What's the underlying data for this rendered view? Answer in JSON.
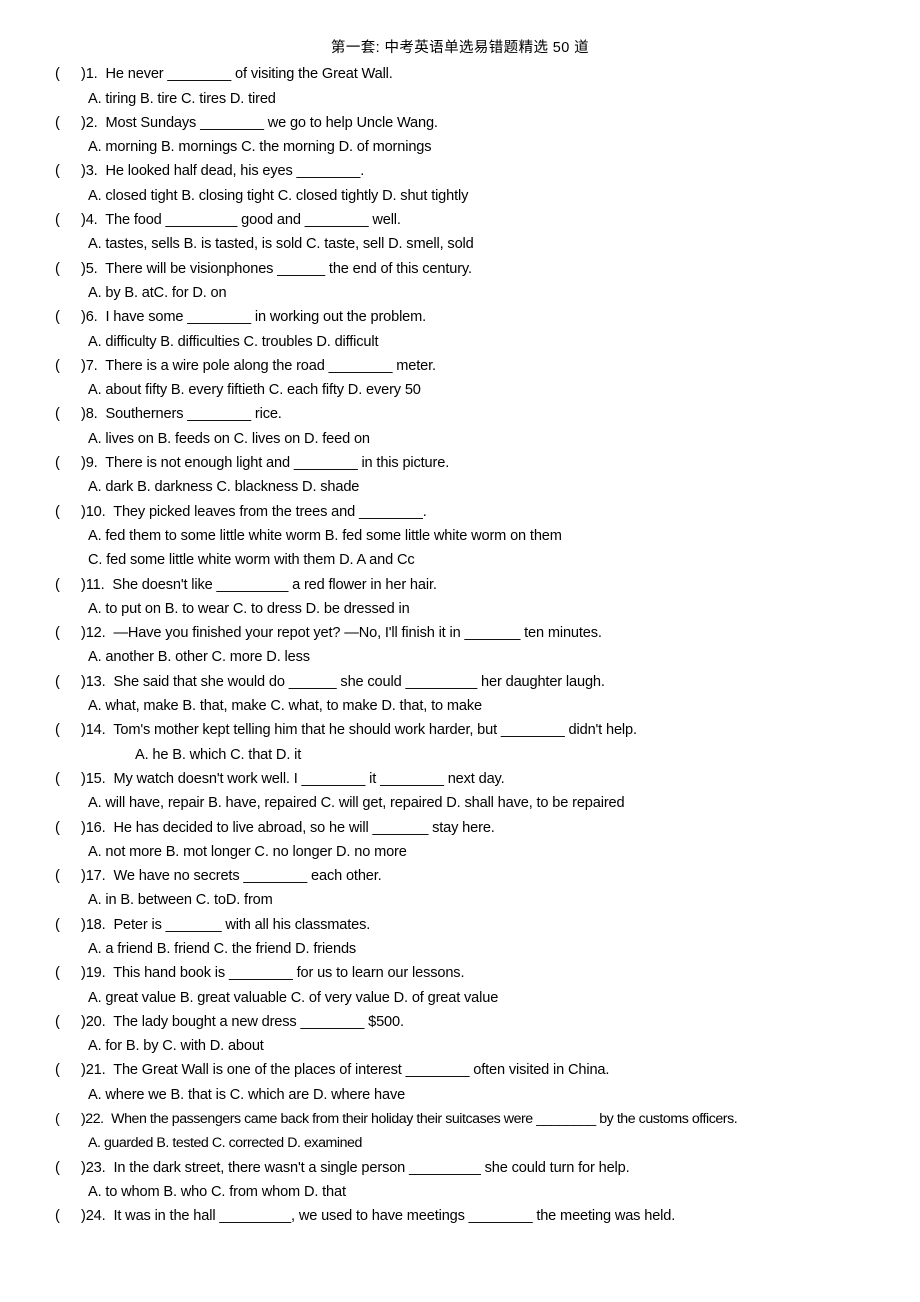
{
  "document": {
    "title": "第一套: 中考英语单选易错题精选 50 道",
    "bracket_open": "(",
    "bracket_close": ")"
  },
  "questions": [
    {
      "number": "1.",
      "stem": "He never ________ of visiting the Great Wall.",
      "option_lines": [
        "A. tiring  B. tire     C. tires    D. tired"
      ]
    },
    {
      "number": "2.",
      "stem": "Most Sundays ________ we go to help Uncle Wang.",
      "option_lines": [
        "A. morning      B. mornings   C. the morning       D. of mornings"
      ]
    },
    {
      "number": "3.",
      "stem": "He looked half dead, his eyes ________.",
      "option_lines": [
        "A. closed tight B. closing tight     C. closed tightly     D. shut tightly"
      ]
    },
    {
      "number": "4.",
      "stem": "The food _________ good and ________ well.",
      "option_lines": [
        "A. tastes, sells          B. is tasted, is sold       C. taste, sell        D. smell, sold"
      ]
    },
    {
      "number": "5.",
      "stem": "There will be visionphones ______ the end of this century.",
      "option_lines": [
        "A. by      B. atC. for      D. on"
      ]
    },
    {
      "number": "6.",
      "stem": "I have some ________ in working out the problem.",
      "option_lines": [
        "A. difficulty    B. difficulties C. troubles     D. difficult"
      ]
    },
    {
      "number": "7.",
      "stem": "There is a wire pole along the road ________ meter.",
      "option_lines": [
        "A. about fifty  B. every fiftieth     C. each fifty   D. every 50"
      ]
    },
    {
      "number": "8.",
      "stem": "Southerners ________ rice.",
      "option_lines": [
        "A. lives on      B. feeds on    C. lives on      D. feed on"
      ]
    },
    {
      "number": "9.",
      "stem": "There is not enough light and ________ in this picture.",
      "option_lines": [
        "A. dark    B. darkness    C. blackness   D. shade"
      ]
    },
    {
      "number": "10.",
      "stem": "They picked leaves from the trees and ________.",
      "option_lines": [
        "A. fed them to some little white worm  B. fed some little white worm on them",
        "C. fed some little white worm with them       D. A and Cc"
      ]
    },
    {
      "number": "11.",
      "stem": "She doesn't like _________ a red flower in her hair.",
      "option_lines": [
        "A. to put on    B. to wear     C. to dress     D. be dressed in"
      ]
    },
    {
      "number": "12.",
      "stem": "—Have you finished your repot yet?   —No, I'll finish it in _______ ten minutes.",
      "option_lines": [
        "A. another     B. other  C. more   D. less"
      ]
    },
    {
      "number": "13.",
      "stem": "She said that she would do ______ she could _________ her daughter laugh.",
      "option_lines": [
        "A. what, make B. that, make  C. what, to make     D. that, to make"
      ]
    },
    {
      "number": "14.",
      "stem": "Tom's mother kept telling him that he should work harder, but ________ didn't help.",
      "option_lines": [
        "A. he      B. which C. that     D. it"
      ],
      "options_indent_extra": true
    },
    {
      "number": "15.",
      "stem": "My watch doesn't work well. I ________ it ________ next day.",
      "option_lines": [
        "A. will have, repair       B. have, repaired       C. will get, repaired      D. shall have, to be repaired"
      ]
    },
    {
      "number": "16.",
      "stem": "He has decided to live abroad, so he will _______ stay here.",
      "option_lines": [
        "A. not more    B. mot longer C. no longer   D. no more"
      ]
    },
    {
      "number": "17.",
      "stem": "We have no secrets ________ each other.",
      "option_lines": [
        "A. in      B. between    C. toD. from"
      ]
    },
    {
      "number": "18.",
      "stem": "Peter is _______ with all his classmates.",
      "option_lines": [
        "A. a friend     B. friend C. the friend   D. friends"
      ]
    },
    {
      "number": "19.",
      "stem": "This hand book is ________ for us to learn our lessons.",
      "option_lines": [
        "A. great value B. great valuable    C. of very value     D. of great value"
      ]
    },
    {
      "number": "20.",
      "stem": "The lady bought a new dress ________ $500.",
      "option_lines": [
        "A. for     B. by     C. with    D. about"
      ]
    },
    {
      "number": "21.",
      "stem": "The Great Wall is one of the places of interest ________ often visited in China.",
      "option_lines": [
        "A. where we   B. that is C. which are   D. where have"
      ]
    },
    {
      "number": "22.",
      "stem": "When the passengers came back from their holiday their suitcases were ________ by the customs officers.",
      "option_lines": [
        "A. guarded     B. tested C. corrected   D. examined"
      ],
      "tight": true
    },
    {
      "number": "23.",
      "stem": "In the dark street, there wasn't a single person _________ she could turn for help.",
      "option_lines": [
        "A. to whom    B. who   C. from whom D. that"
      ]
    },
    {
      "number": "24.",
      "stem": "It was in the hall _________, we used to have meetings ________ the meeting was held.",
      "option_lines": []
    }
  ]
}
